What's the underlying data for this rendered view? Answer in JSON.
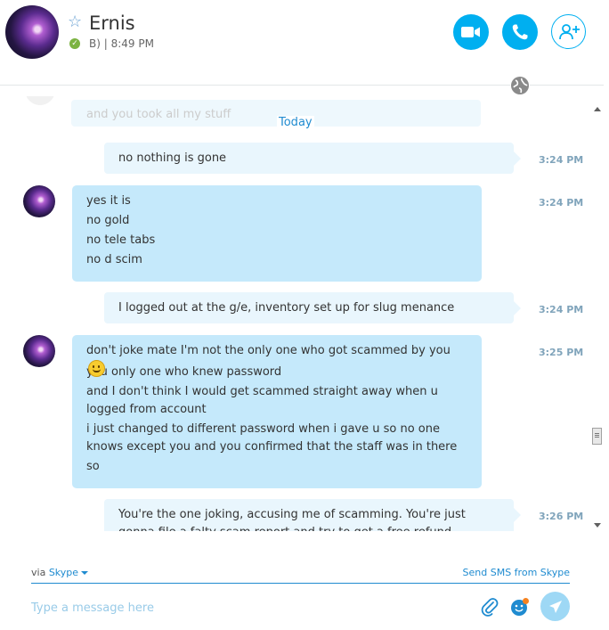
{
  "contact": {
    "name": "Ernis",
    "mood": "B) | 8:49 PM",
    "status_icon": "online-check-icon"
  },
  "header_actions": {
    "video_call": "video-camera-icon",
    "voice_call": "phone-icon",
    "add_people": "add-person-icon"
  },
  "conversation": {
    "faded_previous": "and you took all my stuff",
    "date_separator": "Today",
    "messages": [
      {
        "direction": "outgoing",
        "time": "3:24 PM",
        "lines": [
          "no nothing is gone"
        ]
      },
      {
        "direction": "incoming",
        "time": "3:24 PM",
        "lines": [
          "yes it is",
          "no gold",
          "no tele tabs",
          "no d scim"
        ]
      },
      {
        "direction": "outgoing",
        "time": "3:24 PM",
        "lines": [
          "I logged out at the g/e, inventory set up for slug menance"
        ]
      },
      {
        "direction": "incoming",
        "time": "3:25 PM",
        "lines": [
          "don't joke mate I'm not the only one who got scammed by you",
          "you only one who knew password",
          "and I don't think I would get scammed straight away when u logged from account",
          "i just changed to different password when i gave u so no one knows except you and you confirmed that the staff was in there",
          "so"
        ]
      },
      {
        "direction": "outgoing",
        "time": "3:26 PM",
        "lines": [
          "You're the one joking, accusing me of scamming. You're just gonna file a falty scam report and try to get a free refund"
        ]
      }
    ]
  },
  "footer": {
    "via_label": "via",
    "via_service": "Skype",
    "send_sms": "Send SMS from Skype",
    "message_placeholder": "Type a message here"
  },
  "colors": {
    "accent": "#00aff0",
    "incoming_bubble": "#c5e9fb",
    "outgoing_bubble": "#e9f6fd",
    "timestamp": "#80a4bb"
  }
}
